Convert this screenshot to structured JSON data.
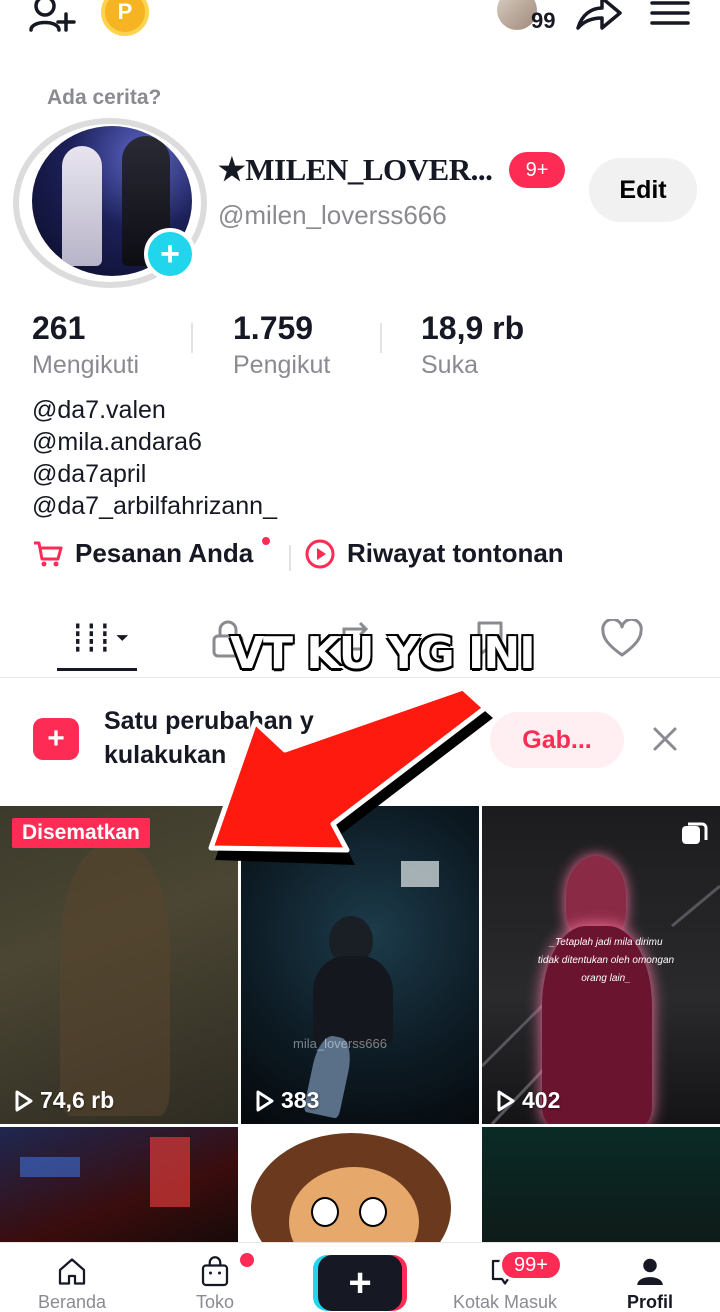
{
  "top_bar": {
    "avatar_count": "99",
    "coin_letter": "P"
  },
  "profile": {
    "story_label": "Ada cerita?",
    "username": "★MILEN_LOVER...",
    "notification_badge": "9+",
    "handle": "@milen_loverss666",
    "edit_label": "Edit"
  },
  "stats": [
    {
      "value": "261",
      "label": "Mengikuti"
    },
    {
      "value": "1.759",
      "label": "Pengikut"
    },
    {
      "value": "18,9 rb",
      "label": "Suka"
    }
  ],
  "bio_lines": [
    "@da7.valen",
    "@mila.andara6",
    "@da7april",
    "@da7_arbilfahrizann_"
  ],
  "quick_links": {
    "orders": "Pesanan Anda",
    "history": "Riwayat tontonan"
  },
  "annotation": {
    "text": "VT KU YG INI",
    "arrow_color": "#ff1a10"
  },
  "banner": {
    "line1": "Satu perubahan y",
    "line2": "kulakukan",
    "join_label": "Gab..."
  },
  "grid": {
    "pinned_label": "Disematkan",
    "videos": [
      {
        "views": "74,6 rb"
      },
      {
        "views": "383",
        "watermark": "mila_loverss666"
      },
      {
        "views": "402",
        "caption_line1": "_Tetaplah jadi mila dirimu",
        "caption_line2": "tidak ditentukan oleh omongan",
        "caption_line3": "orang lain_"
      }
    ]
  },
  "bottom_nav": {
    "home": "Beranda",
    "shop": "Toko",
    "inbox": "Kotak Masuk",
    "profile": "Profil",
    "inbox_badge": "99+"
  },
  "colors": {
    "accent": "#fe2c55",
    "cyan": "#20d5ec",
    "text": "#161823",
    "muted": "#8a8b91"
  }
}
